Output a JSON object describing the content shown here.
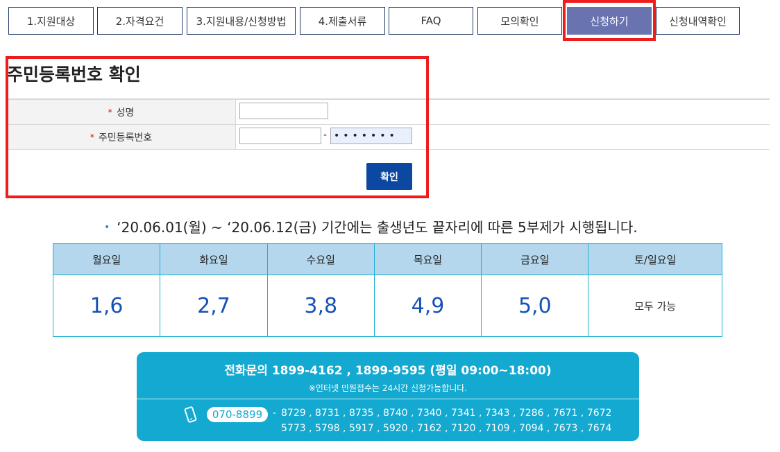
{
  "tabs": [
    {
      "label": "1.지원대상",
      "active": false
    },
    {
      "label": "2.자격요건",
      "active": false
    },
    {
      "label": "3.지원내용/신청방법",
      "active": false
    },
    {
      "label": "4.제출서류",
      "active": false
    },
    {
      "label": "FAQ",
      "active": false
    },
    {
      "label": "모의확인",
      "active": false
    },
    {
      "label": "신청하기",
      "active": true
    },
    {
      "label": "신청내역확인",
      "active": false
    }
  ],
  "form": {
    "title": "주민등록번호 확인",
    "required_mark": "*",
    "name_label": "성명",
    "name_value": "",
    "rrn_label": "주민등록번호",
    "rrn_front_value": "",
    "rrn_separator": "-",
    "rrn_back_value": "•••••••",
    "confirm_label": "확인"
  },
  "notice": {
    "bullet": "•",
    "text": "‘20.06.01(월) ~ ‘20.06.12(금) 기간에는 출생년도 끝자리에 따른 5부제가 시행됩니다."
  },
  "schedule": {
    "headers": [
      "월요일",
      "화요일",
      "수요일",
      "목요일",
      "금요일",
      "토/일요일"
    ],
    "values": [
      "1,6",
      "2,7",
      "3,8",
      "4,9",
      "5,0",
      "모두 가능"
    ]
  },
  "contact": {
    "main_line": "전화문의  1899-4162 , 1899-9595 (평일 09:00~18:00)",
    "sub_line": "※인터넷 민원접수는 24시간 신청가능합니다.",
    "pill_number": "070-8899",
    "ext_separator": "-",
    "extensions_line1": "8729 , 8731 , 8735 , 8740 , 7340 , 7341 , 7343 , 7286 , 7671 , 7672",
    "extensions_line2": "5773 , 5798 , 5917 , 5920 , 7162 , 7120 , 7109 , 7094 , 7673 , 7674",
    "phone_icon": "mobile-phone-icon"
  },
  "colors": {
    "active_tab": "#6873b0",
    "highlight": "#ee1c1c",
    "confirm_button": "#0c47a1",
    "table_header": "#b4d7ee",
    "table_value": "#1652b5",
    "contact_bg": "#13a9d0"
  }
}
